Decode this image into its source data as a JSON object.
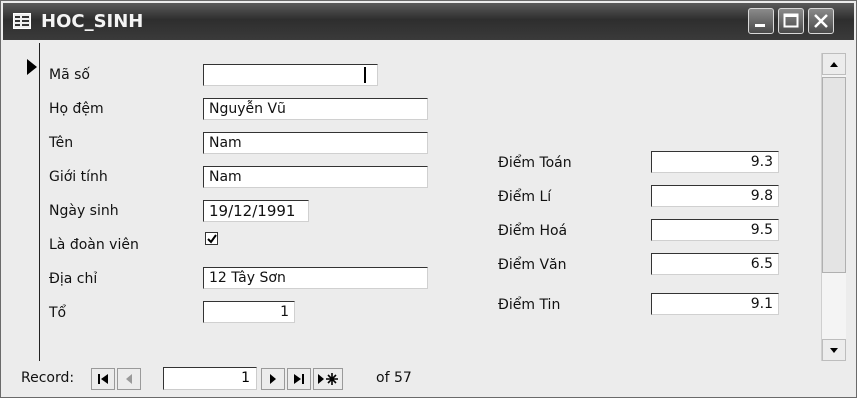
{
  "window": {
    "title": "HOC_SINH",
    "icon": "form-icon",
    "controls": [
      "minimize-icon",
      "maximize-icon",
      "close-icon"
    ]
  },
  "form": {
    "left_fields": [
      {
        "label": "Mã số",
        "value": ""
      },
      {
        "label": "Họ đệm",
        "value": "Nguyễn Vũ"
      },
      {
        "label": "Tên",
        "value": "Nam"
      },
      {
        "label": "Giới tính",
        "value": "Nam"
      },
      {
        "label": "Ngày sinh",
        "value": "19/12/1991"
      },
      {
        "label": "Là đoàn viên",
        "checked": true
      },
      {
        "label": "Địa chỉ",
        "value": "12 Tây Sơn"
      },
      {
        "label": "Tổ",
        "value": "1"
      }
    ],
    "right_fields": [
      {
        "label": "Điểm Toán",
        "value": "9.3"
      },
      {
        "label": "Điểm Lí",
        "value": "9.8"
      },
      {
        "label": "Điểm Hoá",
        "value": "9.5"
      },
      {
        "label": "Điểm Văn",
        "value": "6.5"
      },
      {
        "label": "Điểm Tin",
        "value": "9.1"
      }
    ]
  },
  "navigation": {
    "label": "Record:",
    "current": "1",
    "of_text": "of 57",
    "buttons": [
      "first-record-icon",
      "previous-record-icon",
      "next-record-icon",
      "last-record-icon",
      "new-record-icon"
    ]
  }
}
